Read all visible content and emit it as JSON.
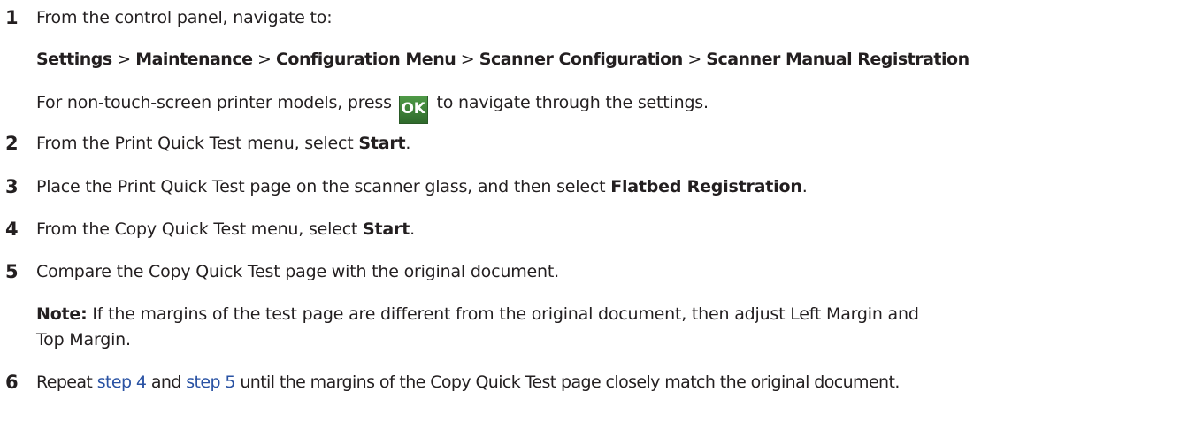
{
  "steps": [
    {
      "number": "1",
      "intro": "From the control panel, navigate to:",
      "path": [
        "Settings",
        "Maintenance",
        "Configuration Menu",
        "Scanner Configuration",
        "Scanner Manual Registration"
      ],
      "path_separator": ">",
      "note_before": "For non-touch-screen printer models, press",
      "button_label": "OK",
      "note_after": "to navigate through the settings."
    },
    {
      "number": "2",
      "text_before": "From the Print Quick Test menu, select",
      "bold": "Start",
      "text_after": "."
    },
    {
      "number": "3",
      "text_before": "Place the Print Quick Test page on the scanner glass, and then select",
      "bold": "Flatbed Registration",
      "text_after": "."
    },
    {
      "number": "4",
      "text_before": "From the Copy Quick Test menu, select",
      "bold": "Start",
      "text_after": "."
    },
    {
      "number": "5",
      "text": "Compare the Copy Quick Test page with the original document.",
      "note_label": "Note:",
      "note_line1": "If the margins of the test page are different from the original document, then adjust Left Margin and",
      "note_line2": "Top Margin."
    },
    {
      "number": "6",
      "text_before": "Repeat",
      "link1": "step 4",
      "text_middle": "and",
      "link2": "step 5",
      "text_after": "until the margins of the Copy Quick Test page closely match the original document."
    }
  ],
  "colors": {
    "text": "#231f20",
    "link": "#2952a3",
    "ok_button": "#3f7f3a"
  }
}
